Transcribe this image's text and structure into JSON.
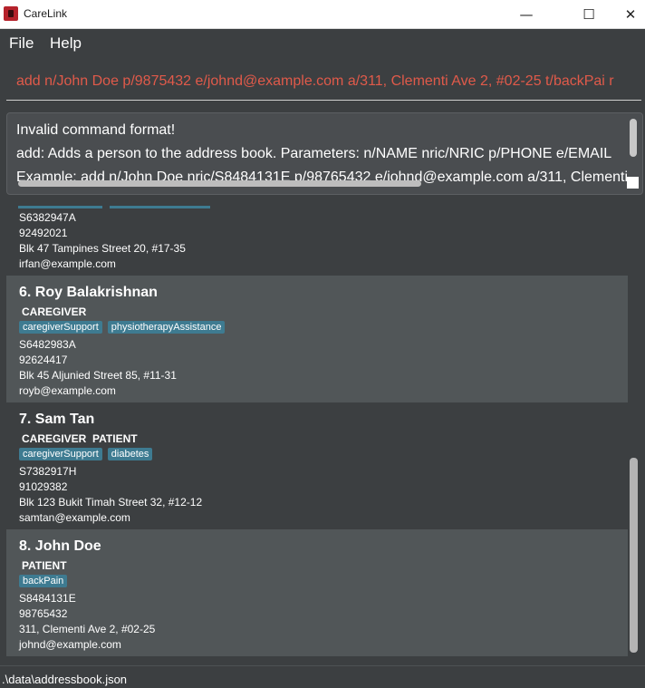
{
  "window": {
    "title": "CareLink",
    "minimize_glyph": "—",
    "maximize_glyph": "☐",
    "close_glyph": "✕"
  },
  "menu": {
    "items": [
      "File",
      "Help"
    ]
  },
  "command": {
    "text": "add n/John Doe p/9875432 e/johnd@example.com a/311, Clementi Ave 2, #02-25 t/backPai r"
  },
  "result": {
    "lines": [
      "Invalid command format!",
      "add: Adds a person to the address book. Parameters: n/NAME nric/NRIC p/PHONE e/EMAIL",
      "Example: add n/John Doe nric/S8484131E p/98765432 e/johnd@example.com a/311, Clementi"
    ]
  },
  "persons": [
    {
      "name": "",
      "role": "",
      "tags": [],
      "nric": "S6382947A",
      "phone": "92492021",
      "address": "Blk 47 Tampines Street 20, #17-35",
      "email": "irfan@example.com"
    },
    {
      "name": "6. Roy Balakrishnan",
      "role": "CAREGIVER",
      "tags": [
        "caregiverSupport",
        "physiotherapyAssistance"
      ],
      "nric": "S6482983A",
      "phone": "92624417",
      "address": "Blk 45 Aljunied Street 85, #11-31",
      "email": "royb@example.com"
    },
    {
      "name": "7. Sam Tan",
      "role": "CAREGIVER  PATIENT",
      "tags": [
        "caregiverSupport",
        "diabetes"
      ],
      "nric": "S7382917H",
      "phone": "91029382",
      "address": "Blk 123 Bukit Timah Street 32, #12-12",
      "email": "samtan@example.com"
    },
    {
      "name": "8. John Doe",
      "role": "PATIENT",
      "tags": [
        "backPain"
      ],
      "nric": "S8484131E",
      "phone": "98765432",
      "address": "311, Clementi Ave 2, #02-25",
      "email": "johnd@example.com"
    }
  ],
  "status": {
    "path": ".\\data\\addressbook.json"
  }
}
